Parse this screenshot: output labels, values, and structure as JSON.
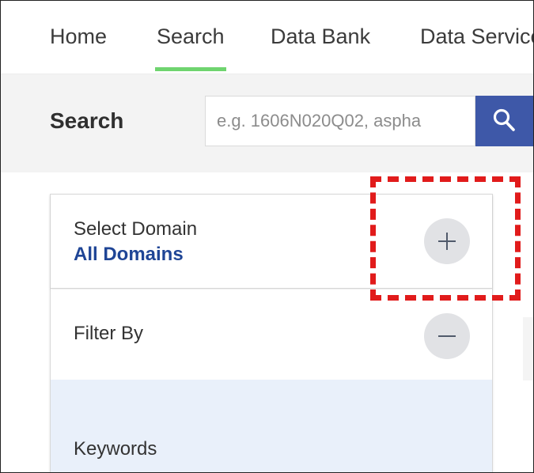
{
  "nav": {
    "items": [
      "Home",
      "Search",
      "Data Bank",
      "Data Services"
    ],
    "active": "Search",
    "active_color": "#6fd46f"
  },
  "search": {
    "title": "Search",
    "placeholder": "e.g. 1606N020Q02, aspha",
    "button_icon": "search-icon",
    "button_color": "#3e58a8"
  },
  "panel": {
    "domain": {
      "label": "Select Domain",
      "value": "All Domains",
      "value_color": "#1f4596",
      "toggle_icon": "plus-icon"
    },
    "filter": {
      "label": "Filter By",
      "toggle_icon": "minus-icon"
    },
    "keywords": {
      "label": "Keywords",
      "background": "#e9f0fa"
    }
  },
  "annotation": {
    "color": "#e11b1b",
    "style": "dashed"
  }
}
